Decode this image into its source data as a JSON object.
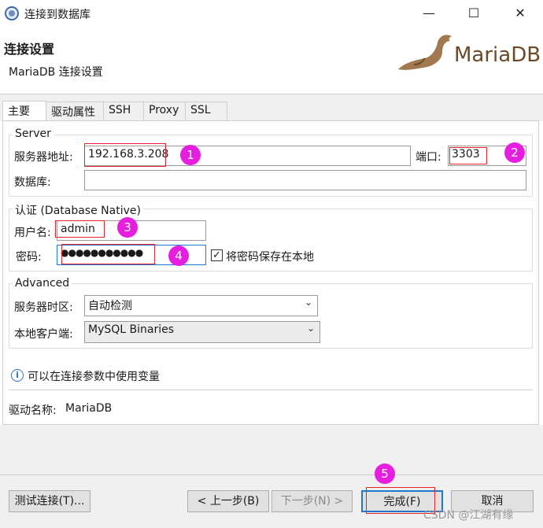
{
  "window": {
    "title": "连接到数据库",
    "minimize": "—",
    "maximize": "☐",
    "close": "✕"
  },
  "header": {
    "title": "连接设置",
    "subtitle": "MariaDB 连接设置",
    "logo_text": "MariaDB"
  },
  "tabs": [
    "主要",
    "驱动属性",
    "SSH",
    "Proxy",
    "SSL"
  ],
  "server": {
    "group_title": "Server",
    "host_label": "服务器地址:",
    "host_value": "192.168.3.208",
    "port_label": "端口:",
    "port_value": "3303",
    "database_label": "数据库:",
    "database_value": ""
  },
  "auth": {
    "group_title": "认证 (Database Native)",
    "user_label": "用户名:",
    "user_value": "admin",
    "password_label": "密码:",
    "password_value": "●●●●●●●●●●●",
    "save_password_label": "将密码保存在本地",
    "save_password_checked": true
  },
  "advanced": {
    "group_title": "Advanced",
    "timezone_label": "服务器时区:",
    "timezone_value": "自动检测",
    "client_label": "本地客户端:",
    "client_value": "MySQL Binaries"
  },
  "info_text": "可以在连接参数中使用变量",
  "driver": {
    "label": "驱动名称:",
    "value": "MariaDB"
  },
  "annotations": [
    "1",
    "2",
    "3",
    "4",
    "5"
  ],
  "buttons": {
    "test": "测试连接(T)...",
    "back": "< 上一步(B)",
    "next": "下一步(N) >",
    "finish": "完成(F)",
    "cancel": "取消"
  },
  "watermark": "CSDN @江湖有缘",
  "colors": {
    "annotation_circle": "#e61ee0",
    "annotation_box": "#e8222a",
    "primary_border": "#1f78d0",
    "logo": "#6b4a2a"
  }
}
